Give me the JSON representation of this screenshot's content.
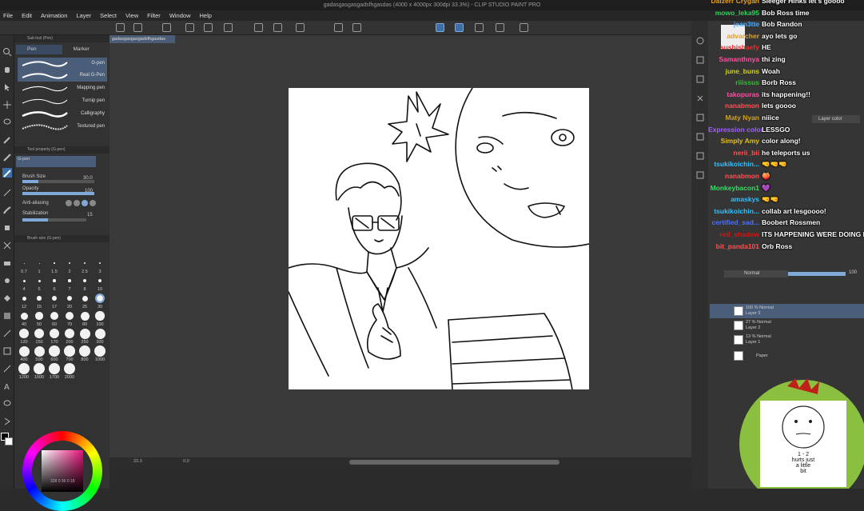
{
  "app": {
    "title": "gadasgasgasgadsfhgasdas (4000 x 4000px 300dpi 33.3%) - CLIP STUDIO PAINT PRO",
    "document_tab": "gadasgasgasgadsfhgasdas"
  },
  "menu": [
    "File",
    "Edit",
    "Animation",
    "Layer",
    "Select",
    "View",
    "Filter",
    "Window",
    "Help"
  ],
  "subtool": {
    "panel_title": "Sub tool (Pen)",
    "tabs": [
      "Pen",
      "Marker"
    ],
    "brushes": [
      {
        "label": "G-pen",
        "selected": true
      },
      {
        "label": "Real G-Pen",
        "selected": true
      },
      {
        "label": "Mapping pen",
        "selected": false
      },
      {
        "label": "Turnip pen",
        "selected": false
      },
      {
        "label": "Calligraphy",
        "selected": false
      },
      {
        "label": "Textured pen",
        "selected": false
      }
    ]
  },
  "tool_property": {
    "title": "Tool property (G-pen)",
    "brush_name": "G-pen",
    "brush_size_label": "Brush Size",
    "brush_size_value": "30.0",
    "opacity_label": "Opacity",
    "opacity_value": "100",
    "antialiasing_label": "Anti-aliasing",
    "stabilization_label": "Stabilization",
    "stabilization_value": "15"
  },
  "brush_size_panel": {
    "title": "Brush size (G-pen)",
    "sizes": [
      "0.7",
      "1",
      "1.5",
      "2",
      "2.5",
      "3",
      "4",
      "5",
      "6",
      "7",
      "8",
      "10",
      "12",
      "15",
      "17",
      "20",
      "25",
      "30",
      "40",
      "50",
      "60",
      "70",
      "80",
      "100",
      "120",
      "150",
      "170",
      "200",
      "250",
      "300",
      "400",
      "500",
      "600",
      "700",
      "800",
      "1000",
      "1200",
      "1500",
      "1700",
      "2000"
    ],
    "selected": "30"
  },
  "color": {
    "main": "#000000",
    "sub": "#ffffff",
    "readout": "328 0 36 0 18"
  },
  "navigator": {
    "zoom": "33.3",
    "rotation": "0.0"
  },
  "chat": [
    {
      "name": "Dalzerr Crygan",
      "msg": "Sleeger Hinks let's goooo",
      "color": "#e8a020"
    },
    {
      "name": "mowo_leka95",
      "msg": "Bob Ross time",
      "color": "#2fd15a"
    },
    {
      "name": "jean3tte",
      "msg": "Bob Randon",
      "color": "#4aa8ff"
    },
    {
      "name": "advarcher",
      "msg": "ayo lets go",
      "color": "#e0a030"
    },
    {
      "name": "sushishaefy",
      "msg": "HE",
      "color": "#e03030"
    },
    {
      "name": "Samanthnya",
      "msg": "thi   zing",
      "color": "#ff4fa0"
    },
    {
      "name": "june_buns",
      "msg": "Woah",
      "color": "#d0d020"
    },
    {
      "name": "riiissus",
      "msg": "Borb Ross",
      "color": "#30c030"
    },
    {
      "name": "takopuras",
      "msg": "its happening!!",
      "color": "#ff4fa0"
    },
    {
      "name": "nanabmon",
      "msg": "lets goooo",
      "color": "#ff5050"
    },
    {
      "name": "Maty Nyan",
      "msg": "niiice",
      "color": "#d0a020"
    },
    {
      "name": "Expression color",
      "msg": "LESSGO",
      "color": "#a060ff"
    },
    {
      "name": "Simply Amy",
      "msg": "color along!",
      "color": "#e0c020"
    },
    {
      "name": "nerii_bii",
      "msg": "he teleports us",
      "color": "#ff5050"
    },
    {
      "name": "tsukikoichin...",
      "msg": "🤜🤜🤜",
      "color": "#30c0ff"
    },
    {
      "name": "nanabmon",
      "msg": "🍑",
      "color": "#ff5050"
    },
    {
      "name": "Monkeybacon1",
      "msg": "💜",
      "color": "#30e060"
    },
    {
      "name": "amaskys",
      "msg": "🤜🤜",
      "color": "#30c0ff"
    },
    {
      "name": "tsukikoichin...",
      "msg": "collab art lesgoooo!",
      "color": "#30c0ff"
    },
    {
      "name": "certified_sad...",
      "msg": "Boobert Rossmen",
      "color": "#4a70ff"
    },
    {
      "name": "red_shadow",
      "msg": "ITS HAPPENING WERE DOING IT",
      "color": "#e01010"
    },
    {
      "name": "bit_panda101",
      "msg": "Orb Ross",
      "color": "#ff5050"
    }
  ],
  "layer_panel": {
    "blend_mode": "Normal",
    "opacity": "100",
    "layer_color_label": "Layer color",
    "layers": [
      {
        "line1": "100 % Normal",
        "line2": "Layer 3",
        "selected": true
      },
      {
        "line1": "27 % Normal",
        "line2": "Layer 2",
        "selected": false
      },
      {
        "line1": "13 % Normal",
        "line2": "Layer 1",
        "selected": false
      },
      {
        "line1": "Paper",
        "line2": "",
        "selected": false
      }
    ]
  },
  "webcam": {
    "card_text": [
      "1 - 2",
      "hurts just",
      "a little",
      "bit"
    ]
  }
}
